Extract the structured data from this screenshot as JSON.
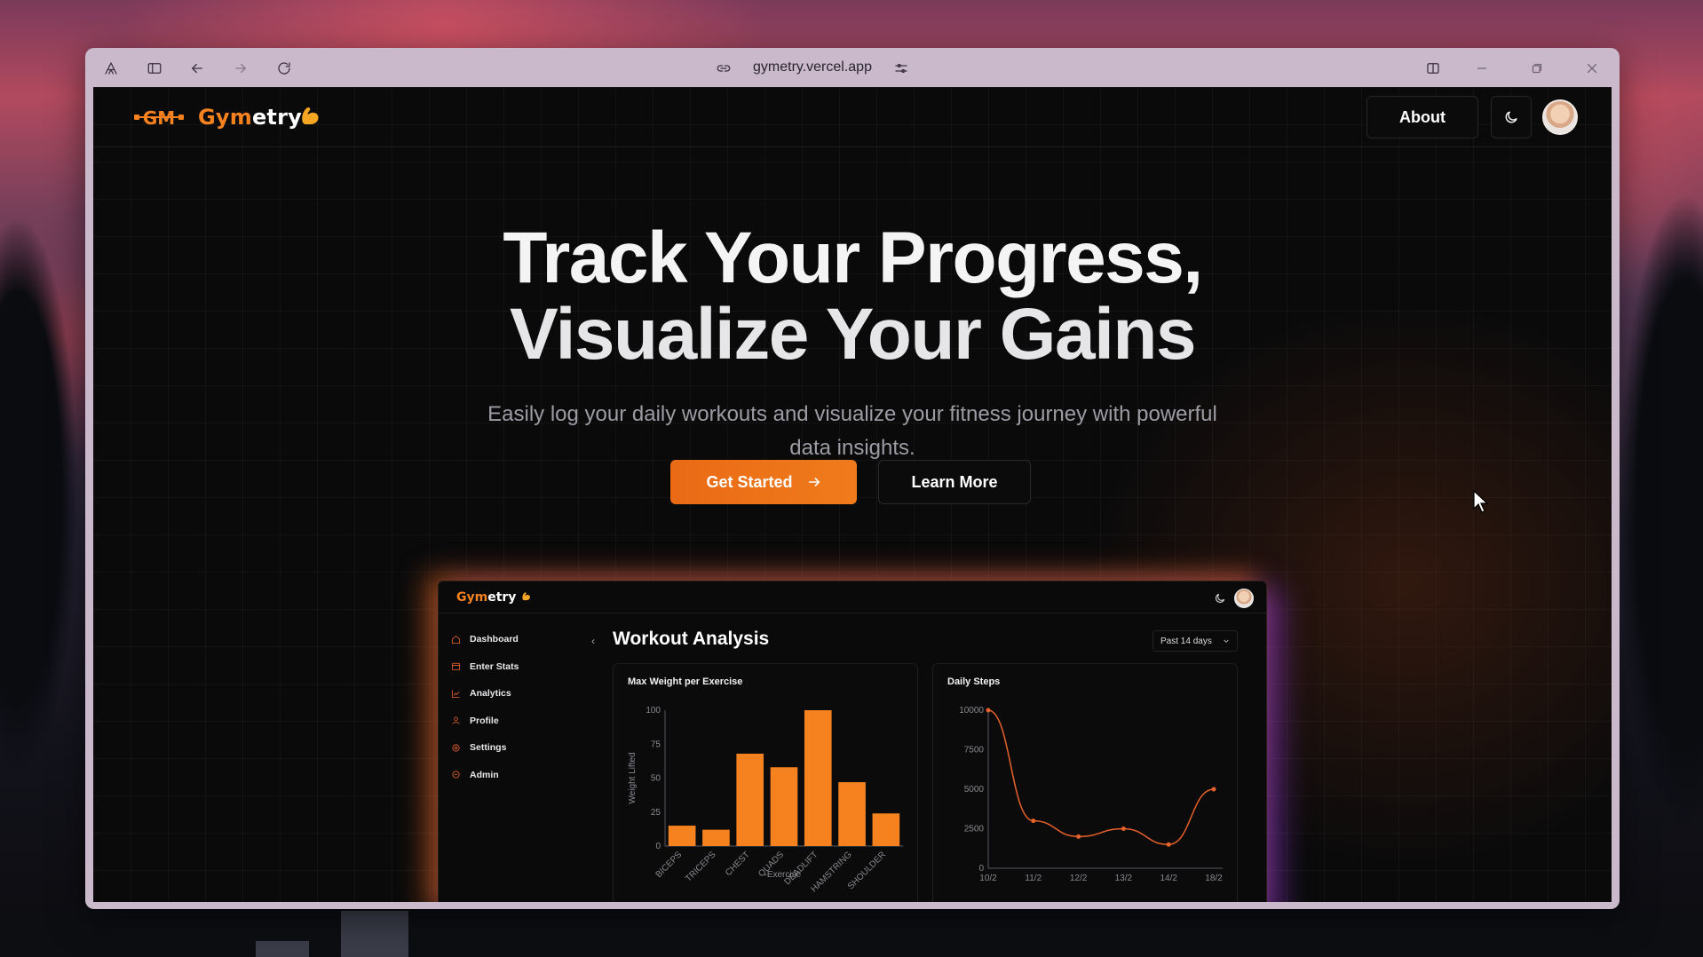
{
  "browser": {
    "url": "gymetry.vercel.app"
  },
  "nav": {
    "logo_brand_first": "Gym",
    "logo_brand_second": "etry",
    "about_label": "About"
  },
  "hero": {
    "title_line1": "Track Your Progress,",
    "title_line2": "Visualize Your Gains",
    "subtitle": "Easily log your daily workouts and visualize your fitness journey with powerful data insights.",
    "primary_cta": "Get Started",
    "secondary_cta": "Learn More"
  },
  "preview": {
    "logo_brand_first": "Gym",
    "logo_brand_second": "etry",
    "title": "Workout Analysis",
    "range_select": "Past 14 days",
    "sidebar": [
      {
        "label": "Dashboard",
        "icon": "home-icon"
      },
      {
        "label": "Enter Stats",
        "icon": "calendar-icon"
      },
      {
        "label": "Analytics",
        "icon": "line-chart-icon"
      },
      {
        "label": "Profile",
        "icon": "user-icon"
      },
      {
        "label": "Settings",
        "icon": "gear-icon"
      },
      {
        "label": "Admin",
        "icon": "shield-icon"
      }
    ]
  },
  "colors": {
    "accent": "#f5821f",
    "background": "#0a0a0b",
    "cta_gradient_start": "#ea6a15",
    "glow_orange": "#f06e1e",
    "glow_purple": "#963cdc"
  },
  "chart_data": [
    {
      "type": "bar",
      "title": "Max Weight per Exercise",
      "xlabel": "Exercise",
      "ylabel": "Weight Lifted",
      "categories": [
        "BICEPS",
        "TRICEPS",
        "CHEST",
        "QUADS",
        "DEADLIFT",
        "HAMSTRING",
        "SHOULDER"
      ],
      "values": [
        15,
        12,
        68,
        58,
        100,
        47,
        24
      ],
      "ylim": [
        0,
        100
      ],
      "yticks": [
        0,
        25,
        50,
        75,
        100
      ],
      "color": "#f5821f",
      "grid": false
    },
    {
      "type": "line",
      "title": "Daily Steps",
      "x": [
        "10/2",
        "11/2",
        "12/2",
        "13/2",
        "14/2",
        "18/2"
      ],
      "values": [
        10000,
        3000,
        2000,
        2500,
        1500,
        5000
      ],
      "ylim": [
        0,
        10000
      ],
      "yticks": [
        0,
        2500,
        5000,
        7500,
        10000
      ],
      "color": "#e8612a",
      "grid": false
    }
  ]
}
